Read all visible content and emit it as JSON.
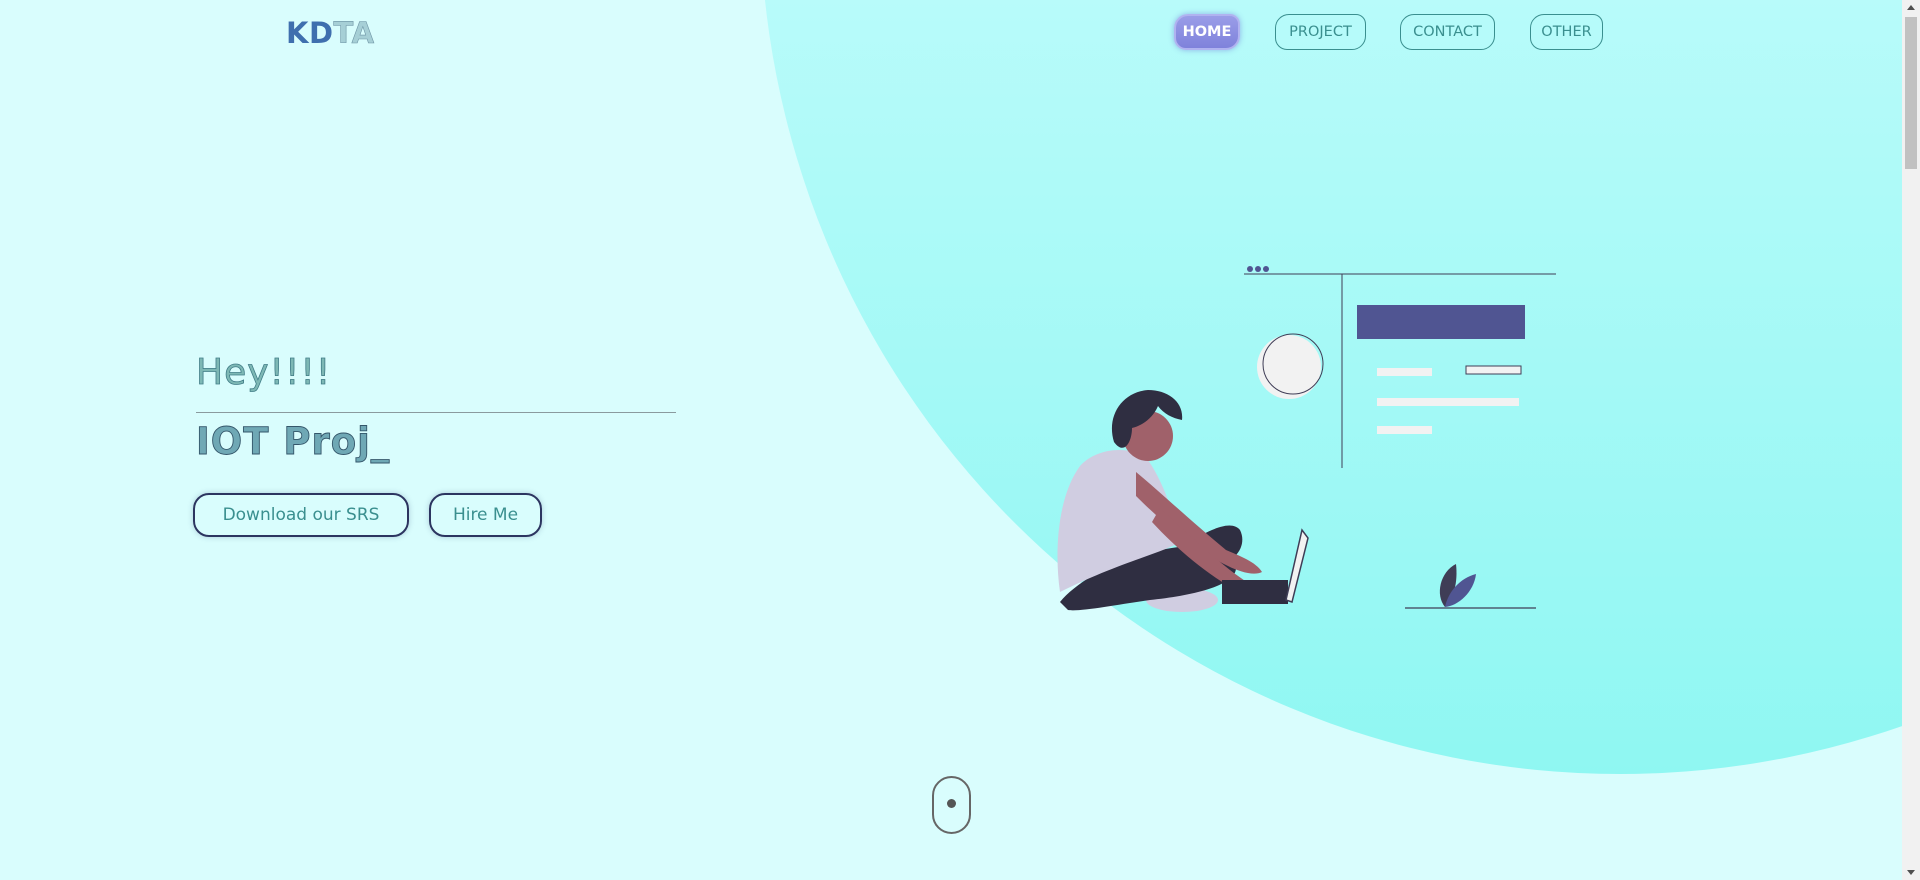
{
  "logo": {
    "part1": "KD",
    "part2": "TA"
  },
  "nav": {
    "items": [
      {
        "label": "HOME",
        "active": true
      },
      {
        "label": "PROJECT",
        "active": false
      },
      {
        "label": "CONTACT",
        "active": false
      },
      {
        "label": "OTHER",
        "active": false
      }
    ]
  },
  "hero": {
    "greeting": "Hey!!!!",
    "title": "IOT Proj_",
    "buttons": {
      "download": "Download our SRS",
      "hire": "Hire Me"
    }
  },
  "icons": {
    "scroll": "scroll-mouse-icon"
  },
  "colors": {
    "background": "#d9fdfd",
    "accent": "#3a8f8f",
    "nav_active": "#8a8de0",
    "illustration_primary": "#505592"
  }
}
